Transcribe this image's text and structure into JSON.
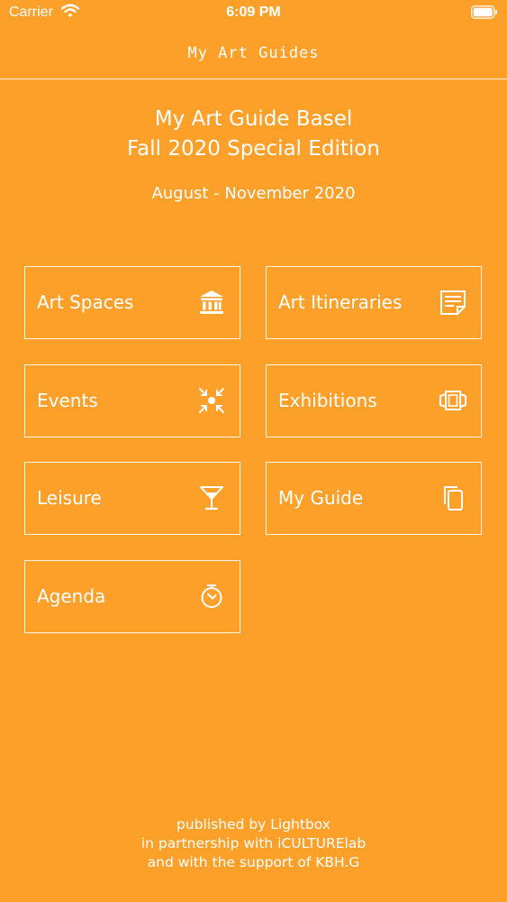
{
  "status_bar": {
    "carrier": "Carrier",
    "time": "6:09 PM"
  },
  "nav": {
    "title": "My Art Guides"
  },
  "header": {
    "title_line1": "My Art Guide Basel",
    "title_line2": "Fall 2020 Special Edition",
    "dates": "August - November 2020"
  },
  "menu": {
    "art_spaces": "Art Spaces",
    "art_itineraries": "Art Itineraries",
    "events": "Events",
    "exhibitions": "Exhibitions",
    "leisure": "Leisure",
    "my_guide": "My Guide",
    "agenda": "Agenda"
  },
  "footer": {
    "line1": "published by Lightbox",
    "line2": "in partnership with iCULTURElab",
    "line3": "and with the support of KBH.G"
  },
  "colors": {
    "background": "#FDA02A",
    "foreground": "#FFFFFF"
  }
}
